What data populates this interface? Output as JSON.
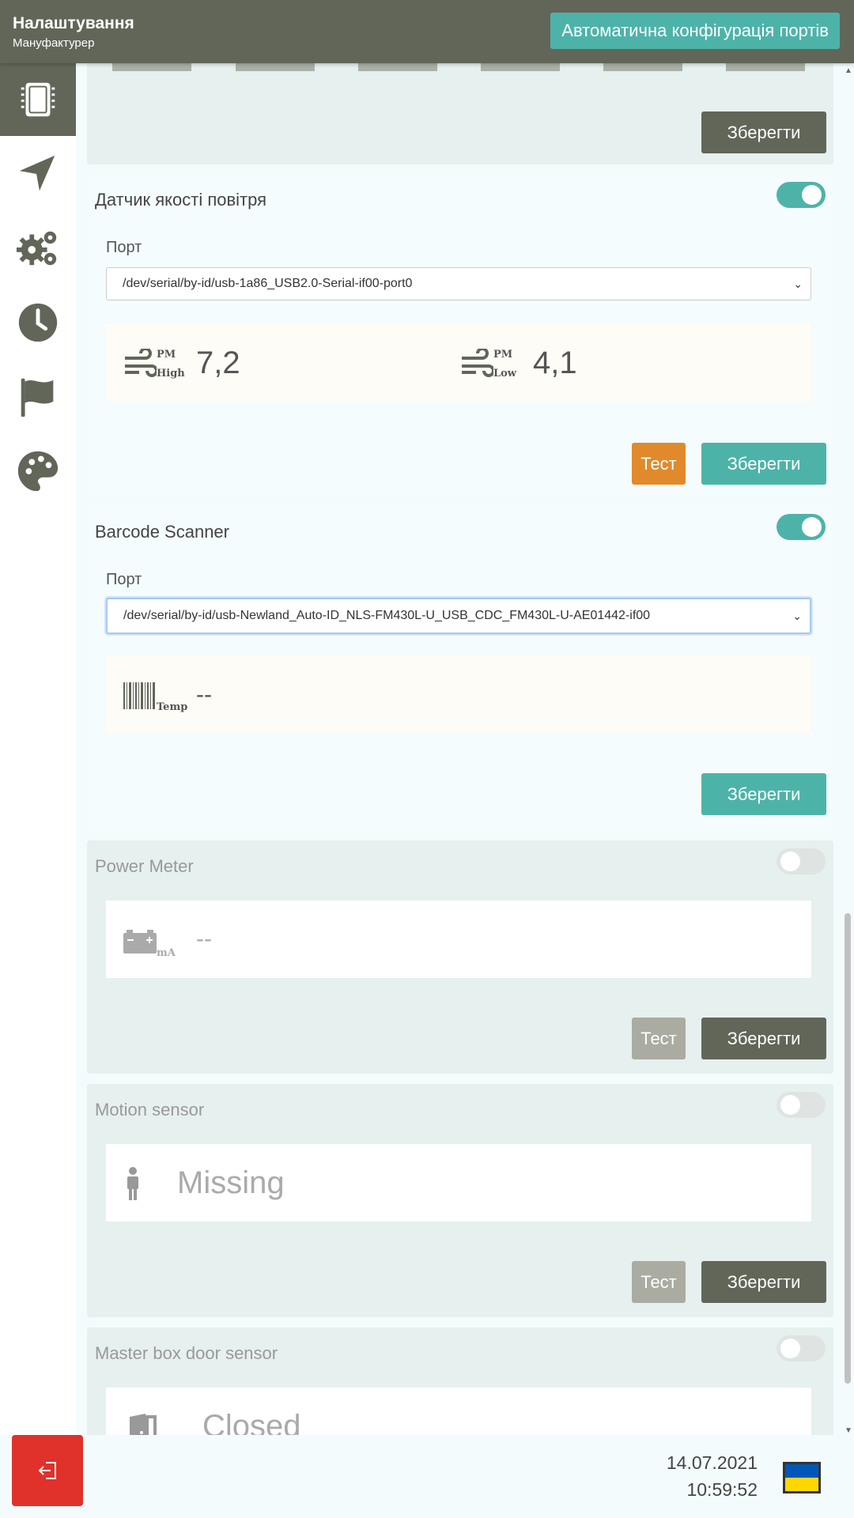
{
  "header": {
    "title": "Налаштування",
    "subtitle": "Мануфактурер",
    "auto_config_label": "Автоматична конфігурація портів"
  },
  "sidebar": {
    "items": [
      {
        "icon": "chip-icon",
        "active": true
      },
      {
        "icon": "navigation-icon",
        "active": false
      },
      {
        "icon": "gears-icon",
        "active": false
      },
      {
        "icon": "clock-icon",
        "active": false
      },
      {
        "icon": "flag-icon",
        "active": false
      },
      {
        "icon": "palette-icon",
        "active": false
      }
    ]
  },
  "cards": {
    "top": {
      "save_label": "Зберегти"
    },
    "air": {
      "title": "Датчик якості повітря",
      "enabled": true,
      "port_label": "Порт",
      "port_value": "/dev/serial/by-id/usb-1a86_USB2.0-Serial-if00-port0",
      "pm_high": {
        "sup": "PM",
        "sub": "High",
        "value": "7,2"
      },
      "pm_low": {
        "sup": "PM",
        "sub": "Low",
        "value": "4,1"
      },
      "test_label": "Тест",
      "save_label": "Зберегти"
    },
    "barcode": {
      "title": "Barcode Scanner",
      "enabled": true,
      "port_label": "Порт",
      "port_value": "/dev/serial/by-id/usb-Newland_Auto-ID_NLS-FM430L-U_USB_CDC_FM430L-U-AE01442-if00",
      "reading": {
        "sub": "Temp",
        "value": "--"
      },
      "save_label": "Зберегти"
    },
    "power": {
      "title": "Power Meter",
      "enabled": false,
      "reading": {
        "sub": "mA",
        "value": "--"
      },
      "test_label": "Тест",
      "save_label": "Зберегти"
    },
    "motion": {
      "title": "Motion sensor",
      "enabled": false,
      "status": "Missing",
      "test_label": "Тест",
      "save_label": "Зберегти"
    },
    "door": {
      "title": "Master box door sensor",
      "enabled": false,
      "status": "Closed"
    }
  },
  "footer": {
    "logout_icon": "logout-icon",
    "date": "14.07.2021",
    "time": "10:59:52",
    "flag": "ukraine-flag"
  },
  "colors": {
    "header": "#626659",
    "accent": "#4db3a9",
    "test_orange": "#e08a2c",
    "logout_red": "#e0312a"
  }
}
